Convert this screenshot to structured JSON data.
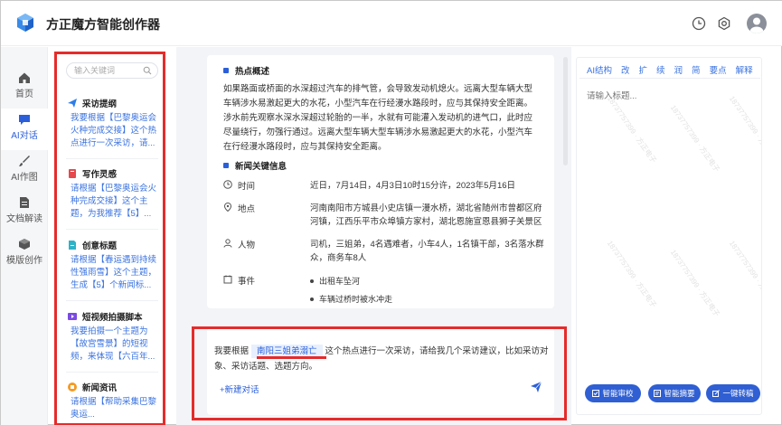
{
  "app": {
    "title": "方正魔方智能创作器"
  },
  "colors": {
    "accent": "#2b5fd9",
    "highlight_red": "#e62b2b",
    "link_blue": "#3a73e0"
  },
  "nav": {
    "items": [
      {
        "label": "首页",
        "icon": "home-icon"
      },
      {
        "label": "AI对话",
        "icon": "chat-icon",
        "active": true
      },
      {
        "label": "AI作图",
        "icon": "brush-icon"
      },
      {
        "label": "文档解读",
        "icon": "document-icon"
      },
      {
        "label": "模版创作",
        "icon": "cube-icon"
      }
    ]
  },
  "templates": {
    "search_placeholder": "输入关键词",
    "items": [
      {
        "title": "采访提纲",
        "icon": "send-plane-icon",
        "desc": "我要根据【巴黎奥运会火种完成交接】这个热点进行一次采访，请..."
      },
      {
        "title": "写作灵感",
        "icon": "book-icon",
        "desc": "请根据【巴黎奥运会火种完成交接】这个主题，为我推荐【5】..."
      },
      {
        "title": "创意标题",
        "icon": "file-icon",
        "desc": "请根据【春运遇到持续性强雨雪】这个主题，生成【5】个新闻标..."
      },
      {
        "title": "短视频拍摄脚本",
        "icon": "video-icon",
        "desc": "我要拍摄一个主题为【故宫雪景】的短视频，来体现【六百年..."
      },
      {
        "title": "新闻资讯",
        "icon": "news-icon",
        "desc": "请根据【帮助采集巴黎奥运..."
      }
    ]
  },
  "content": {
    "summary_title": "热点概述",
    "summary_text": "如果路面或桥面的水深超过汽车的排气管，会导致发动机熄火。远离大型车辆大型车辆涉水易激起更大的水花，小型汽车在行经漫水路段时，应与其保持安全距离。涉水前先观察水深水深超过轮胎的一半，水就有可能灌入发动机的进气口，此时应尽量绕行，勿强行通过。远离大型车辆大型车辆涉水易激起更大的水花，小型汽车在行经漫水路段时，应与其保持安全距离。",
    "key_info_title": "新闻关键信息",
    "rows": [
      {
        "key": "时间",
        "icon": "clock-icon",
        "value": "近日，7月14日，4月3日10时15分许，2023年5月16日"
      },
      {
        "key": "地点",
        "icon": "location-icon",
        "value": "河南南阳市方城县小史店镇一漫水桥，湖北省随州市曾都区府河镇，江西乐平市众埠镇方家村，湖北恩施宣恩县狮子关景区"
      },
      {
        "key": "人物",
        "icon": "person-icon",
        "value": "司机，三姐弟，4名遇难者，小车4人，1名镇干部，3名落水群众，商务车8人"
      },
      {
        "key": "事件",
        "icon": "event-icon",
        "value": ""
      }
    ],
    "events": [
      "出租车坠河",
      "车辆过桥时被水冲走"
    ]
  },
  "input": {
    "prompt_before": "我要根据",
    "prompt_tag": "南阳三姐弟溺亡",
    "prompt_after": "这个热点进行一次采访，请给我几个采访建议，比如采访对象、采访话题、选题方向。",
    "new_chat": "+新建对话"
  },
  "editor": {
    "toolbar": [
      "AI结构",
      "改",
      "扩",
      "续",
      "润",
      "简",
      "要点",
      "解释"
    ],
    "title_placeholder": "请输入标题...",
    "buttons": [
      {
        "label": "智能审校",
        "icon": "check-icon"
      },
      {
        "label": "智能摘要",
        "icon": "summary-icon"
      },
      {
        "label": "一键转稿",
        "icon": "edit-icon"
      }
    ]
  }
}
